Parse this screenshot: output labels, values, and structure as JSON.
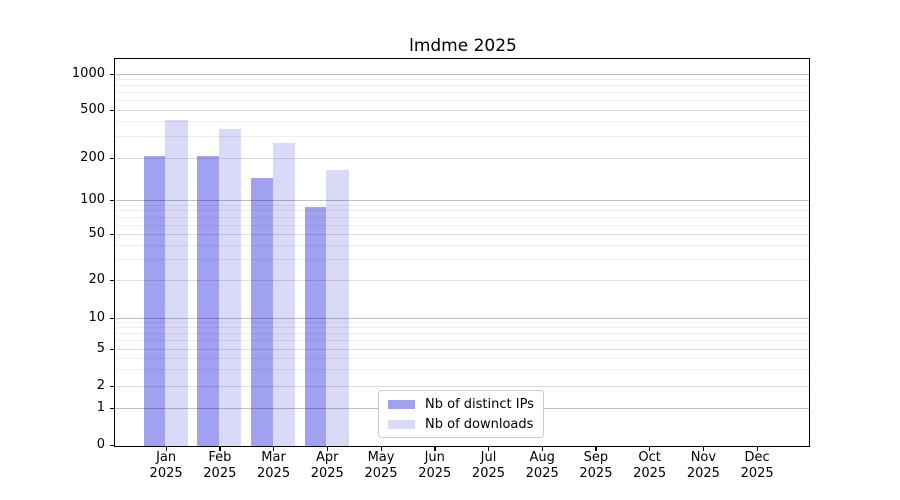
{
  "chart_data": {
    "type": "bar",
    "title": "lmdme 2025",
    "x_months": [
      "Jan",
      "Feb",
      "Mar",
      "Apr",
      "May",
      "Jun",
      "Jul",
      "Aug",
      "Sep",
      "Oct",
      "Nov",
      "Dec"
    ],
    "x_year": "2025",
    "y_ticks": [
      0,
      1,
      2,
      5,
      10,
      20,
      50,
      100,
      200,
      500,
      1000
    ],
    "y_scale": "log-with-zero-baseline",
    "grid": "on",
    "legend_position": "lower-center-inside",
    "series": [
      {
        "name": "Nb of distinct IPs",
        "color": "#a1a1f2",
        "values": [
          210,
          208,
          145,
          87,
          0,
          0,
          0,
          0,
          0,
          0,
          0,
          0
        ]
      },
      {
        "name": "Nb of downloads",
        "color": "#d9d9f8",
        "values": [
          420,
          350,
          268,
          165,
          0,
          0,
          0,
          0,
          0,
          0,
          0,
          0
        ]
      }
    ]
  }
}
